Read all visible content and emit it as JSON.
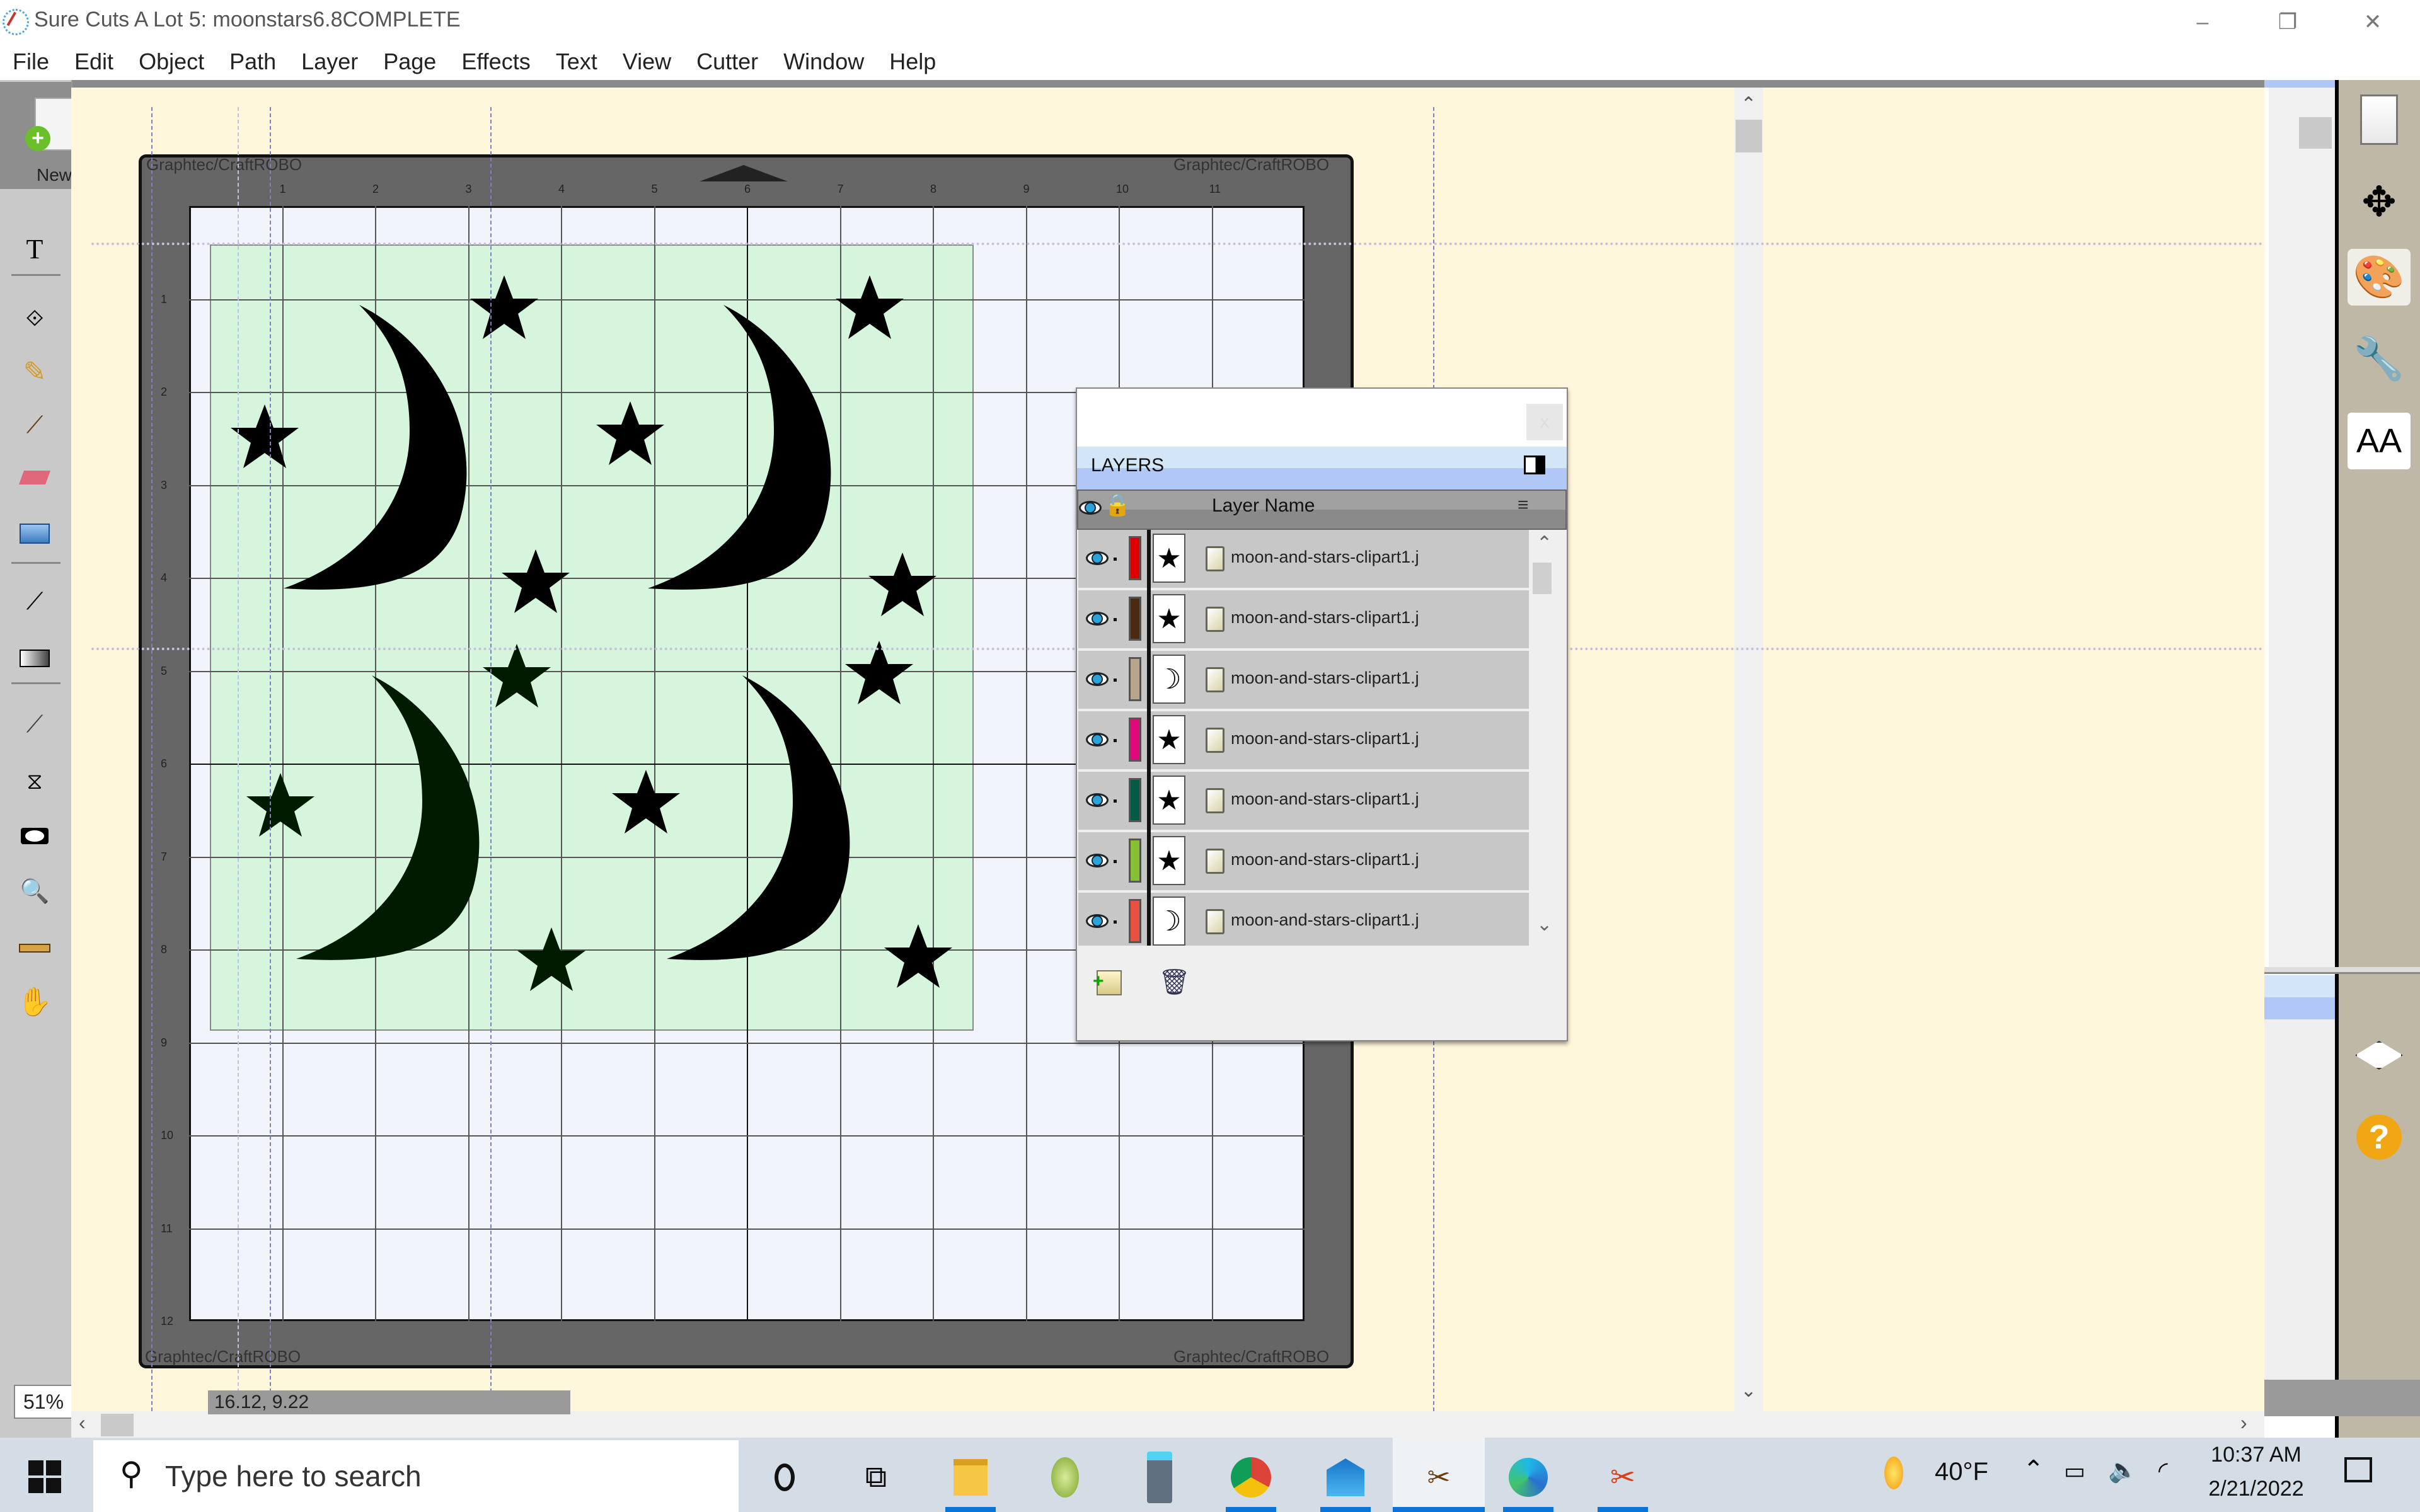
{
  "window": {
    "title": "Sure Cuts A Lot 5: moonstars6.8COMPLETE",
    "controls": {
      "minimize": "–",
      "restore": "❐",
      "close": "✕"
    }
  },
  "menu": [
    "File",
    "Edit",
    "Object",
    "Path",
    "Layer",
    "Page",
    "Effects",
    "Text",
    "View",
    "Cutter",
    "Window",
    "Help"
  ],
  "left_toolbar": {
    "new_label": "New",
    "tools": [
      {
        "name": "text-tool",
        "glyph": "T"
      },
      {
        "name": "node-edit-tool",
        "glyph": "⟐"
      },
      {
        "name": "pencil-tool",
        "glyph": "✎"
      },
      {
        "name": "brush-tool",
        "glyph": "🖌"
      },
      {
        "name": "eraser-tool",
        "glyph": "▱"
      },
      {
        "name": "rectangle-tool",
        "glyph": "▭"
      },
      {
        "name": "eyedropper-tool",
        "glyph": "⟋"
      },
      {
        "name": "gradient-tool",
        "glyph": "▮"
      },
      {
        "name": "knife-tool",
        "glyph": "⟋"
      },
      {
        "name": "transform-tool",
        "glyph": "⧖"
      },
      {
        "name": "view-tool",
        "glyph": "◉"
      },
      {
        "name": "zoom-tool",
        "glyph": "🔍"
      },
      {
        "name": "ruler-tool",
        "glyph": "📏"
      },
      {
        "name": "hand-tool",
        "glyph": "✋"
      }
    ],
    "zoom_level": "51%"
  },
  "canvas": {
    "mat_brand": "Graphtec/CraftROBO",
    "ruler_top": [
      "1",
      "2",
      "3",
      "4",
      "5",
      "6",
      "7",
      "8",
      "9",
      "10",
      "11"
    ],
    "ruler_side": [
      "1",
      "2",
      "3",
      "4",
      "5",
      "6",
      "7",
      "8",
      "9",
      "10",
      "11",
      "12"
    ],
    "cursor_coords": "16.12, 9.22",
    "shapes": [
      {
        "type": "moon",
        "color": "#000000"
      },
      {
        "type": "moon",
        "color": "#000000"
      },
      {
        "type": "moon",
        "color": "#001a00"
      },
      {
        "type": "moon",
        "color": "#000000"
      },
      {
        "type": "star",
        "color": "#000000"
      }
    ]
  },
  "layers_panel": {
    "title": "LAYERS",
    "close": "x",
    "column_header": "Layer Name",
    "layers": [
      {
        "name": "moon-and-stars-clipart1.j",
        "color": "#dd0000",
        "thumb": "★"
      },
      {
        "name": "moon-and-stars-clipart1.j",
        "color": "#4a2a10",
        "thumb": "★"
      },
      {
        "name": "moon-and-stars-clipart1.j",
        "color": "#b8a58c",
        "thumb": "☽"
      },
      {
        "name": "moon-and-stars-clipart1.j",
        "color": "#e0087a",
        "thumb": "★"
      },
      {
        "name": "moon-and-stars-clipart1.j",
        "color": "#055a46",
        "thumb": "★"
      },
      {
        "name": "moon-and-stars-clipart1.j",
        "color": "#86be34",
        "thumb": "★"
      },
      {
        "name": "moon-and-stars-clipart1.j",
        "color": "#e85040",
        "thumb": "☽"
      }
    ],
    "add_layer": "add-layer",
    "delete_layer": "delete-layer"
  },
  "right_sidebar": [
    "page-icon",
    "move-icon",
    "palette-icon",
    "wrench-icon",
    "text-size-icon",
    "layers-icon",
    "help-icon"
  ],
  "taskbar": {
    "search_placeholder": "Type here to search",
    "weather": "40°F",
    "time": "10:37 AM",
    "date": "2/21/2022"
  }
}
